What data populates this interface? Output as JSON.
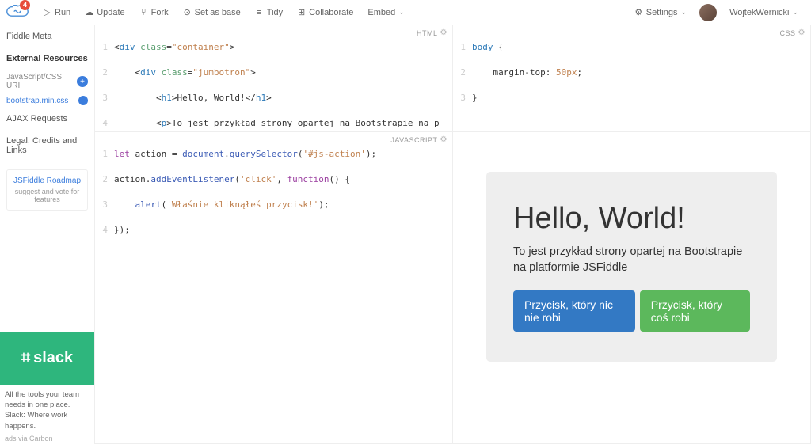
{
  "logo_badge": "4",
  "topbar": {
    "run": "Run",
    "update": "Update",
    "fork": "Fork",
    "setbase": "Set as base",
    "tidy": "Tidy",
    "collab": "Collaborate",
    "embed": "Embed",
    "settings": "Settings",
    "username": "WojtekWernicki"
  },
  "sidebar": {
    "meta": "Fiddle Meta",
    "external": "External Resources",
    "uri_placeholder": "JavaScript/CSS URI",
    "resource1": "bootstrap.min.css",
    "ajax": "AJAX Requests",
    "legal": "Legal, Credits and Links",
    "roadmap": "JSFiddle Roadmap",
    "roadmap_sub": "suggest and vote for features",
    "slack": "slack",
    "ad_text": "All the tools your team needs in one place. Slack: Where work happens.",
    "ad_via": "ads via Carbon"
  },
  "panes": {
    "html_label": "HTML",
    "css_label": "CSS",
    "js_label": "JAVASCRIPT"
  },
  "result": {
    "heading": "Hello, World!",
    "paragraph": "To jest przykład strony opartej na Bootstrapie na platformie JSFiddle",
    "btn1": "Przycisk, który nic nie robi",
    "btn2": "Przycisk, który coś robi"
  }
}
